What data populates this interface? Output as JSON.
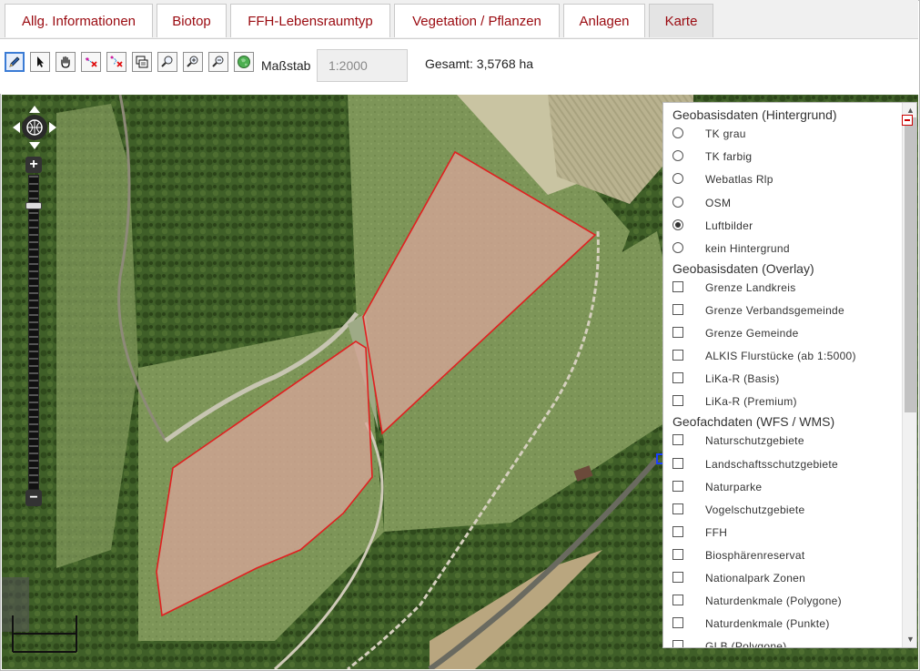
{
  "tabs": [
    {
      "label": "Allg. Informationen"
    },
    {
      "label": "Biotop"
    },
    {
      "label": "FFH-Lebensraumtyp"
    },
    {
      "label": "Vegetation / Pflanzen"
    },
    {
      "label": "Anlagen"
    },
    {
      "label": "Karte",
      "active": true
    }
  ],
  "toolbar": {
    "tools": [
      "pencil-icon",
      "pointer-icon",
      "pan-hand-icon",
      "delete-vertex-icon",
      "delete-polygon-icon",
      "layer-switch-icon",
      "zoom-box-icon",
      "zoom-in-icon",
      "zoom-out-icon",
      "globe-icon"
    ],
    "scale_label": "Maßstab",
    "scale_value": "1:2000",
    "total_text": "Gesamt: 3,5768 ha"
  },
  "map": {
    "polygon_color": "#e02020",
    "polygon_fill": "#d9a59a"
  },
  "layers": {
    "background": {
      "title": "Geobasisdaten (Hintergrund)",
      "options": [
        "TK grau",
        "TK farbig",
        "Webatlas Rlp",
        "OSM",
        "Luftbilder",
        "kein Hintergrund"
      ],
      "selected": "Luftbilder"
    },
    "overlay": {
      "title": "Geobasisdaten (Overlay)",
      "items": [
        "Grenze Landkreis",
        "Grenze Verbandsgemeinde",
        "Grenze Gemeinde",
        "ALKIS Flurstücke (ab 1:5000)",
        "LiKa-R (Basis)",
        "LiKa-R (Premium)"
      ]
    },
    "geofach": {
      "title": "Geofachdaten (WFS / WMS)",
      "items": [
        "Naturschutzgebiete",
        "Landschaftsschutzgebiete",
        "Naturparke",
        "Vogelschutzgebiete",
        "FFH",
        "Biosphärenreservat",
        "Nationalpark Zonen",
        "Naturdenkmale (Polygone)",
        "Naturdenkmale (Punkte)",
        "GLB (Polygone)"
      ]
    }
  }
}
